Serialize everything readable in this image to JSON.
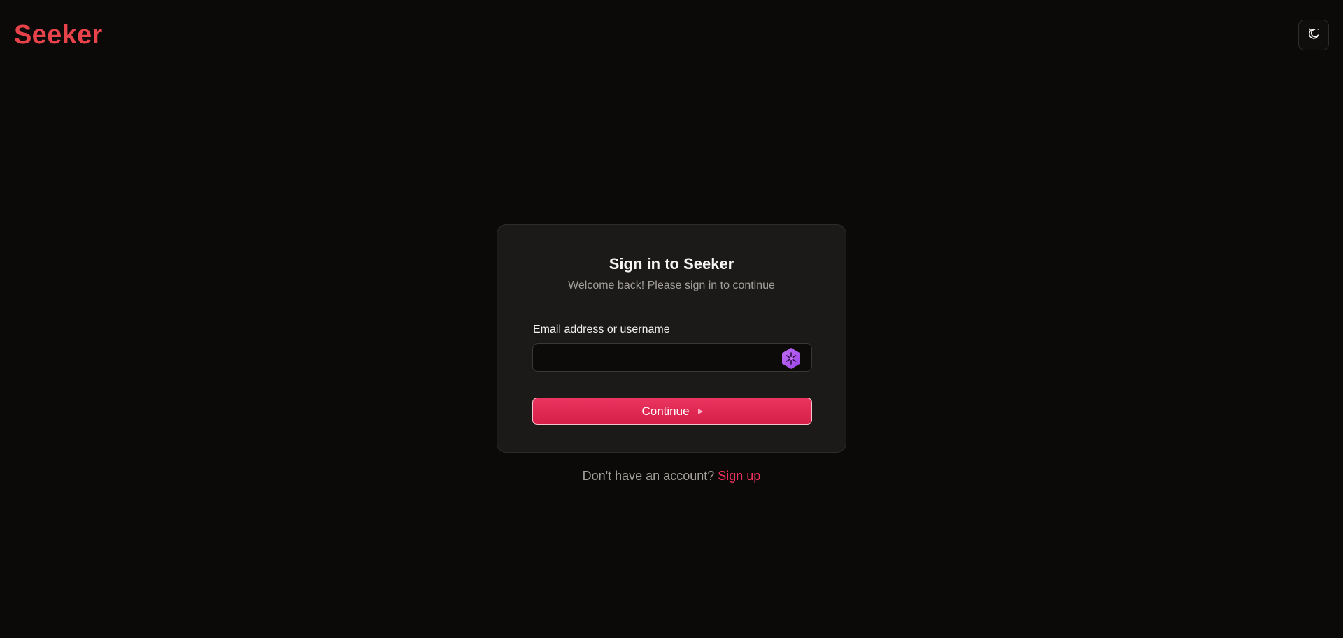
{
  "header": {
    "logo_text": "Seeker",
    "theme_toggle_icon": "moon-stars-icon"
  },
  "signin_card": {
    "title": "Sign in to Seeker",
    "subtitle": "Welcome back! Please sign in to continue",
    "identifier_label": "Email address or username",
    "identifier_value": "",
    "identifier_placeholder": "",
    "password_manager_icon": "hexagon-asterisk-icon",
    "continue_label": "Continue",
    "continue_icon": "caret-right-icon"
  },
  "footer": {
    "prompt_text": "Don't have an account?",
    "signup_label": "Sign up"
  },
  "colors": {
    "background": "#0b0a09",
    "brand": "#e8434a",
    "accent": "#e52a55",
    "card": "#1c1a18",
    "password_manager": "#b45ef0"
  }
}
